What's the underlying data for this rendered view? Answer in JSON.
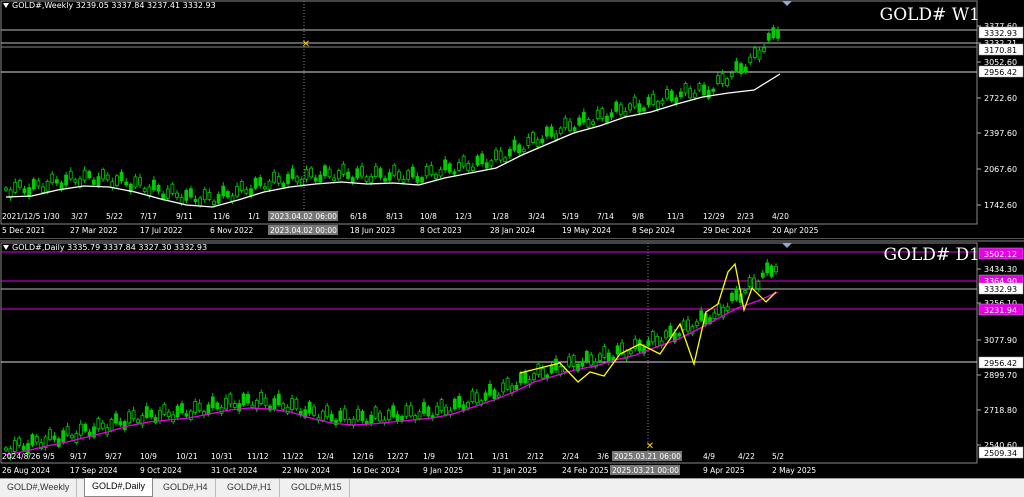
{
  "colors": {
    "background": "#000000",
    "up": "#00cc00",
    "ma_weekly": "#ffffff",
    "ma_daily": "#e600e6",
    "grid": "#777777",
    "marker": "#ffcc00",
    "line_daily": "#ffff00"
  },
  "weekly": {
    "header": "GOLD#,Weekly  3239.05 3337.84 3237.41 3332.93",
    "big_label": "GOLD# W1",
    "price_labels": [
      "3377.60",
      "3332.93",
      "3232.21",
      "3170.81",
      "3052.60",
      "2956.42",
      "2722.60",
      "2397.60",
      "2067.60",
      "1742.60"
    ],
    "upper_time_labels": [
      "2021/12/5 1/30",
      "3/27",
      "5/22",
      "7/17",
      "9/11",
      "11/6",
      "1/1",
      "2023.04.02 06:00",
      "6/18",
      "8/13",
      "10/8",
      "12/3",
      "1/28",
      "3/24",
      "5/19",
      "7/14",
      "9/8",
      "11/3",
      "12/29",
      "2/23",
      "4/20"
    ],
    "lower_time_labels": [
      "5 Dec 2021",
      "27 Mar 2022",
      "17 Jul 2022",
      "6 Nov 2022",
      "2023.04.02 00:00",
      "18 Jun 2023",
      "8 Oct 2023",
      "28 Jan 2024",
      "19 May 2024",
      "8 Sep 2024",
      "29 Dec 2024",
      "20 Apr 2025"
    ],
    "ma_y": [
      197,
      196,
      190,
      186,
      187,
      192,
      199,
      205,
      207,
      200,
      192,
      187,
      184,
      182,
      184,
      183,
      185,
      178,
      173,
      168,
      155,
      144,
      133,
      126,
      117,
      112,
      104,
      97,
      93,
      90,
      74
    ]
  },
  "daily": {
    "header": "GOLD#,Daily  3335.79 3337.84 3327.30 3332.93",
    "big_label": "GOLD# D1",
    "price_labels": [
      "3502.12",
      "3434.30",
      "3364.90",
      "3332.93",
      "3256.10",
      "3231.94",
      "3077.90",
      "2956.42",
      "2899.70",
      "2718.80",
      "2540.60",
      "2509.34"
    ],
    "upper_time_labels": [
      "2024/8/26 9/5",
      "9/17",
      "9/27",
      "10/9",
      "10/21",
      "10/31",
      "11/12",
      "11/22",
      "12/4",
      "12/16",
      "12/27",
      "1/9",
      "1/21",
      "1/31",
      "2/12",
      "2/24",
      "3/6",
      "2025.03.21 06:00",
      "4/9",
      "4/22",
      "5/2"
    ],
    "lower_time_labels": [
      "26 Aug 2024",
      "17 Sep 2024",
      "9 Oct 2024",
      "31 Oct 2024",
      "22 Nov 2024",
      "16 Dec 2024",
      "9 Jan 2025",
      "31 Jan 2025",
      "24 Feb 2025",
      "2025.03.21 00:00",
      "9 Apr 2025",
      "2 May 2025"
    ],
    "ma_y": [
      213,
      209,
      204,
      200,
      195,
      190,
      184,
      180,
      178,
      176,
      172,
      168,
      166,
      167,
      170,
      176,
      181,
      183,
      182,
      180,
      178,
      176,
      172,
      165,
      158,
      150,
      140,
      134,
      128,
      124,
      118,
      113,
      105,
      98,
      88,
      77,
      66,
      59,
      50
    ]
  },
  "tabs": [
    {
      "label": "GOLD#,Weekly",
      "active": false
    },
    {
      "label": "GOLD#,Daily",
      "active": true
    },
    {
      "label": "GOLD#,H4",
      "active": false
    },
    {
      "label": "GOLD#,H1",
      "active": false
    },
    {
      "label": "GOLD#,M15",
      "active": false
    }
  ]
}
